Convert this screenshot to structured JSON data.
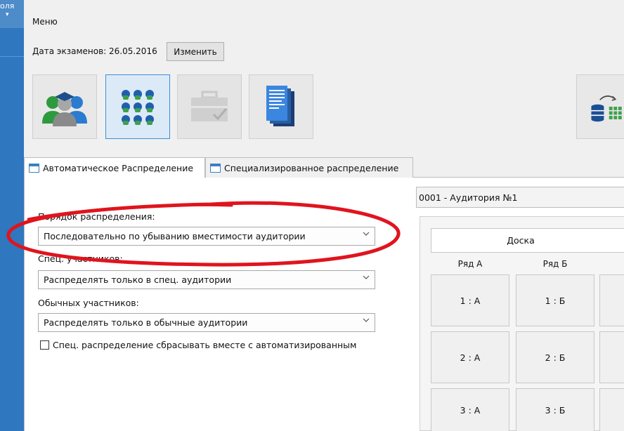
{
  "left_strip": {
    "label": "оля",
    "arrow": "▾"
  },
  "menu": {
    "label": "Меню"
  },
  "exam": {
    "label": "Дата экзаменов: 26.05.2016",
    "change_button": "Изменить"
  },
  "toolbar": {
    "tiles": [
      {
        "icon": "participants-icon",
        "state": "normal"
      },
      {
        "icon": "seating-grid-icon",
        "state": "selected"
      },
      {
        "icon": "briefcase-icon",
        "state": "disabled"
      },
      {
        "icon": "documents-icon",
        "state": "normal"
      },
      {
        "icon": "database-sync-icon",
        "state": "normal"
      }
    ]
  },
  "tabs": [
    {
      "label": "Автоматическое Распределение",
      "active": true
    },
    {
      "label": "Специализированное распределение",
      "active": false
    }
  ],
  "auditorium": {
    "selected": "0001 - Аудитория №1"
  },
  "form": {
    "order_label": "Порядок распределения:",
    "order_value": "Последовательно по убыванию вместимости аудитории",
    "special_label": "Спец. участников:",
    "special_value": "Распределять только в спец. аудитории",
    "regular_label": "Обычных участников:",
    "regular_value": "Распределять только в обычные аудитории",
    "reset_checkbox_label": "Спец. распределение сбрасывать вместе с автоматизированным",
    "reset_checked": false
  },
  "seating": {
    "board": "Доска",
    "row_headers": [
      "Ряд А",
      "Ряд Б"
    ],
    "seats": [
      [
        "1 : А",
        "1 : Б"
      ],
      [
        "2 : А",
        "2 : Б"
      ],
      [
        "3 : А",
        "3 : Б"
      ]
    ]
  },
  "colors": {
    "accent": "#3c7fc3",
    "left_strip": "#2f77bf",
    "highlight_ellipse": "#e0141e"
  }
}
